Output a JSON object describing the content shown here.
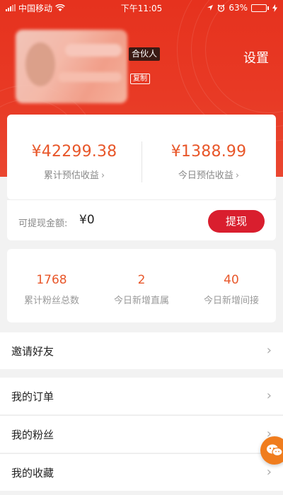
{
  "status_bar": {
    "carrier": "中国移动",
    "time": "下午11:05",
    "battery_percent": "63%",
    "battery_level": 0.63
  },
  "header": {
    "badge": "合伙人",
    "copy_label": "复制",
    "settings_label": "设置"
  },
  "earnings": {
    "total_amount": "¥42299.38",
    "total_label": "累计预估收益",
    "today_amount": "¥1388.99",
    "today_label": "今日预估收益",
    "chevron": "›"
  },
  "withdraw": {
    "label": "可提现金额:",
    "value": "¥0",
    "button": "提现"
  },
  "stats": [
    {
      "value": "1768",
      "label": "累计粉丝总数"
    },
    {
      "value": "2",
      "label": "今日新增直属"
    },
    {
      "value": "40",
      "label": "今日新增间接"
    }
  ],
  "menu": [
    {
      "label": "邀请好友"
    },
    {
      "label": "我的订单"
    },
    {
      "label": "我的粉丝"
    },
    {
      "label": "我的收藏"
    }
  ],
  "colors": {
    "brand_red": "#e6321e",
    "amount_orange": "#e8572a",
    "button_red": "#d91e2e",
    "float_orange": "#f07d1e"
  },
  "icons": [
    "wifi-icon",
    "location-icon",
    "alarm-icon",
    "battery-icon",
    "charging-icon",
    "chevron-right-icon",
    "customer-service-icon"
  ]
}
